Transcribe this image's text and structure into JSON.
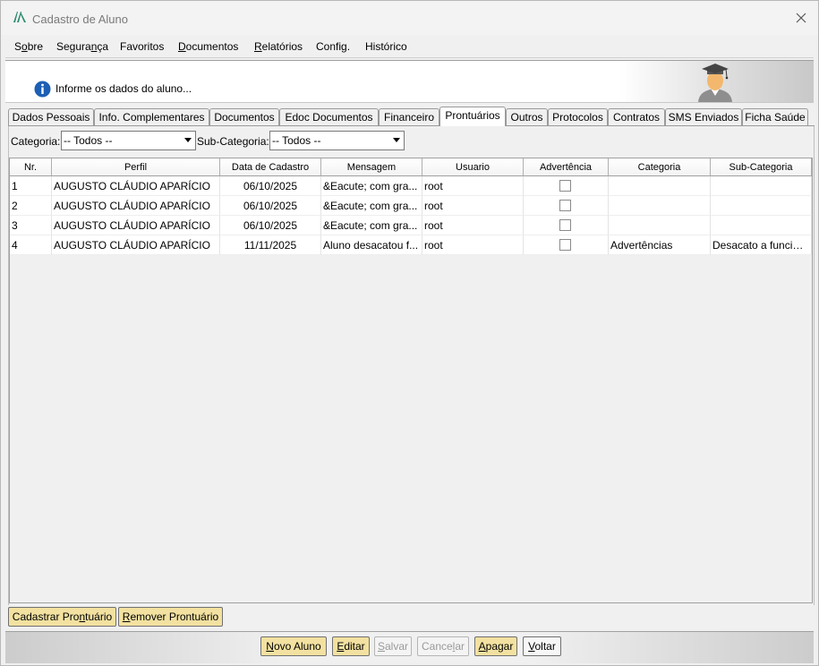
{
  "window": {
    "title": "Cadastro de Aluno"
  },
  "menu": {
    "items": [
      {
        "pre": "S",
        "u": "o",
        "post": "bre"
      },
      {
        "pre": "Segura",
        "u": "n",
        "post": "ça"
      },
      {
        "pre": "Favoritos",
        "u": "",
        "post": ""
      },
      {
        "pre": "",
        "u": "D",
        "post": "ocumentos"
      },
      {
        "pre": "",
        "u": "R",
        "post": "elatórios"
      },
      {
        "pre": "Config.",
        "u": "",
        "post": ""
      },
      {
        "pre": "Histórico",
        "u": "",
        "post": ""
      }
    ]
  },
  "banner": {
    "message": "Informe os dados do aluno..."
  },
  "tabs": [
    {
      "label": "Dados Pessoais"
    },
    {
      "label": "Info. Complementares"
    },
    {
      "label": "Documentos"
    },
    {
      "label": "Edoc Documentos"
    },
    {
      "label": "Financeiro"
    },
    {
      "label": "Prontuários",
      "active": true
    },
    {
      "label": "Outros"
    },
    {
      "label": "Protocolos"
    },
    {
      "label": "Contratos"
    },
    {
      "label": "SMS Enviados"
    },
    {
      "label": "Ficha Saúde"
    }
  ],
  "filters": {
    "categoria_label": "Categoria:",
    "categoria_value": "-- Todos --",
    "subcategoria_label": "Sub-Categoria:",
    "subcategoria_value": "-- Todos --"
  },
  "grid": {
    "columns": [
      "Nr.",
      "Perfil",
      "Data de Cadastro",
      "Mensagem",
      "Usuario",
      "Advertência",
      "Categoria",
      "Sub-Categoria"
    ],
    "rows": [
      {
        "nr": "1",
        "perfil": "AUGUSTO CLÁUDIO APARÍCIO",
        "data": "06/10/2025",
        "mensagem": "&Eacute; com gra...",
        "usuario": "root",
        "advertencia": false,
        "categoria": "",
        "subcategoria": ""
      },
      {
        "nr": "2",
        "perfil": "AUGUSTO CLÁUDIO APARÍCIO",
        "data": "06/10/2025",
        "mensagem": "&Eacute; com gra...",
        "usuario": "root",
        "advertencia": false,
        "categoria": "",
        "subcategoria": ""
      },
      {
        "nr": "3",
        "perfil": "AUGUSTO CLÁUDIO APARÍCIO",
        "data": "06/10/2025",
        "mensagem": "&Eacute; com gra...",
        "usuario": "root",
        "advertencia": false,
        "categoria": "",
        "subcategoria": ""
      },
      {
        "nr": "4",
        "perfil": "AUGUSTO CLÁUDIO APARÍCIO",
        "data": "11/11/2025",
        "mensagem": "Aluno desacatou f...",
        "usuario": "root",
        "advertencia": false,
        "categoria": "Advertências",
        "subcategoria": "Desacato a funcion..."
      }
    ]
  },
  "panel_buttons": {
    "cadastrar": {
      "pre": "Cadastrar Pro",
      "u": "n",
      "post": "tuário"
    },
    "remover": {
      "pre": "",
      "u": "R",
      "post": "emover Prontuário"
    }
  },
  "footer_buttons": {
    "novo": {
      "pre": "",
      "u": "N",
      "post": "ovo Aluno"
    },
    "editar": {
      "pre": "",
      "u": "E",
      "post": "ditar"
    },
    "salvar": {
      "pre": "",
      "u": "S",
      "post": "alvar"
    },
    "cancelar": {
      "pre": "Cance",
      "u": "l",
      "post": "ar"
    },
    "apagar": {
      "pre": "",
      "u": "A",
      "post": "pagar"
    },
    "voltar": {
      "pre": "",
      "u": "V",
      "post": "oltar"
    }
  },
  "colors": {
    "accent_button": "#f2e1a0",
    "info_icon": "#1d5fb4"
  },
  "icons": [
    "app-logo-icon",
    "close-icon",
    "info-icon",
    "student-graduate-icon",
    "dropdown-arrow-icon",
    "checkbox-icon"
  ]
}
